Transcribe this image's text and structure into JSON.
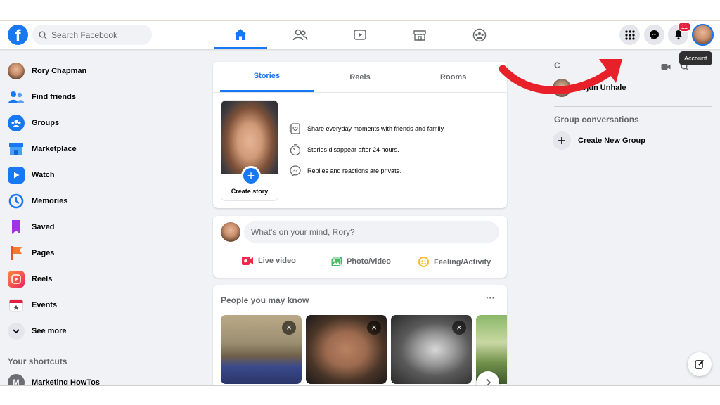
{
  "topbar": {
    "logo": "f",
    "search_placeholder": "Search Facebook",
    "nav_icons": [
      "home-icon",
      "friends-icon",
      "watch-icon",
      "marketplace-icon",
      "groups-icon"
    ],
    "notifications_badge": "11",
    "tooltip": "Account"
  },
  "sidebar": {
    "items": [
      {
        "label": "Rory Chapman",
        "icon": "profile-avatar"
      },
      {
        "label": "Find friends",
        "icon": "friends-icon"
      },
      {
        "label": "Groups",
        "icon": "groups-icon"
      },
      {
        "label": "Marketplace",
        "icon": "marketplace-icon"
      },
      {
        "label": "Watch",
        "icon": "watch-icon"
      },
      {
        "label": "Memories",
        "icon": "memories-icon"
      },
      {
        "label": "Saved",
        "icon": "saved-icon"
      },
      {
        "label": "Pages",
        "icon": "pages-icon"
      },
      {
        "label": "Reels",
        "icon": "reels-icon"
      },
      {
        "label": "Events",
        "icon": "events-icon"
      },
      {
        "label": "See more",
        "icon": "chevron-down-icon"
      }
    ],
    "shortcuts_title": "Your shortcuts",
    "shortcut_item": "Marketing HowTos",
    "shortcut_initial": "M"
  },
  "stories": {
    "tabs": [
      "Stories",
      "Reels",
      "Rooms"
    ],
    "create_label": "Create story",
    "info": [
      "Share everyday moments with friends and family.",
      "Stories disappear after 24 hours.",
      "Replies and reactions are private."
    ]
  },
  "composer": {
    "placeholder": "What's on your mind, Rory?",
    "actions": [
      "Live video",
      "Photo/video",
      "Feeling/Activity"
    ]
  },
  "people": {
    "title": "People you may know",
    "more": "···"
  },
  "right": {
    "contact_name": "Arjun Unhale",
    "group_conversations": "Group conversations",
    "create_group": "Create New Group",
    "contacts_initial": "C"
  },
  "colors": {
    "accent": "#1877f2",
    "badge": "#e41e3f",
    "arrow": "#e8202a"
  }
}
